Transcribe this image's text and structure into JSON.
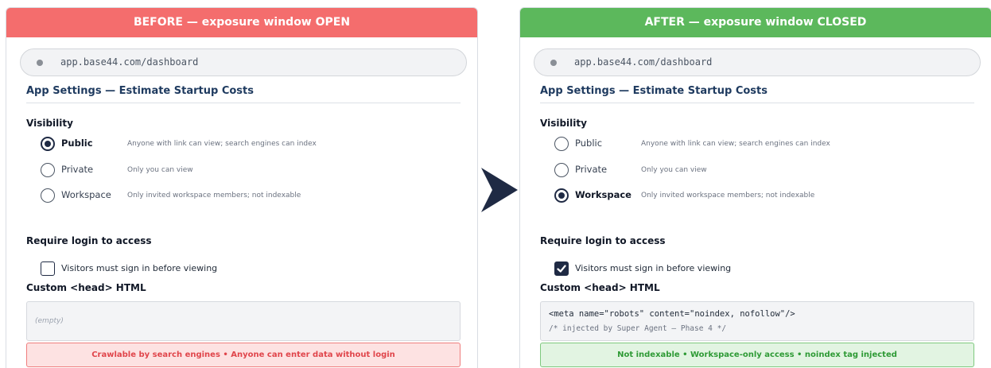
{
  "before": {
    "banner": "BEFORE — exposure window OPEN",
    "url": "app.base44.com/dashboard",
    "app_title": "App Settings — Estimate Startup Costs",
    "visibility_label": "Visibility",
    "options": [
      {
        "label": "Public",
        "desc": "Anyone with link can view; search engines can index",
        "checked": true
      },
      {
        "label": "Private",
        "desc": "Only you can view",
        "checked": false
      },
      {
        "label": "Workspace",
        "desc": "Only invited workspace members; not indexable",
        "checked": false
      }
    ],
    "login_label": "Require login to access",
    "checkbox_label": "Visitors must sign in before viewing",
    "checkbox_checked": false,
    "head_label": "Custom <head> HTML",
    "code_empty": "(empty)",
    "status": "Crawlable by search engines • Anyone can enter data without login",
    "status_color": "#e0454b"
  },
  "after": {
    "banner": "AFTER — exposure window CLOSED",
    "url": "app.base44.com/dashboard",
    "app_title": "App Settings — Estimate Startup Costs",
    "visibility_label": "Visibility",
    "options": [
      {
        "label": "Public",
        "desc": "Anyone with link can view; search engines can index",
        "checked": false
      },
      {
        "label": "Private",
        "desc": "Only you can view",
        "checked": false
      },
      {
        "label": "Workspace",
        "desc": "Only invited workspace members; not indexable",
        "checked": true
      }
    ],
    "login_label": "Require login to access",
    "checkbox_label": "Visitors must sign in before viewing",
    "checkbox_checked": true,
    "head_label": "Custom <head> HTML",
    "code_line1": "<meta name=\"robots\" content=\"noindex, nofollow\"/>",
    "code_line2": "/* injected by Super Agent — Phase 4 */",
    "status": "Not indexable • Workspace-only access • noindex tag injected",
    "status_color": "#2e9a35"
  },
  "colors": {
    "before_banner": "#f46d6d",
    "after_banner": "#5cb85c",
    "arrow": "#1f2a44"
  },
  "icons": {
    "arrow": "arrow-right-icon",
    "url_dot": "dot-icon",
    "check": "checkmark-icon"
  }
}
